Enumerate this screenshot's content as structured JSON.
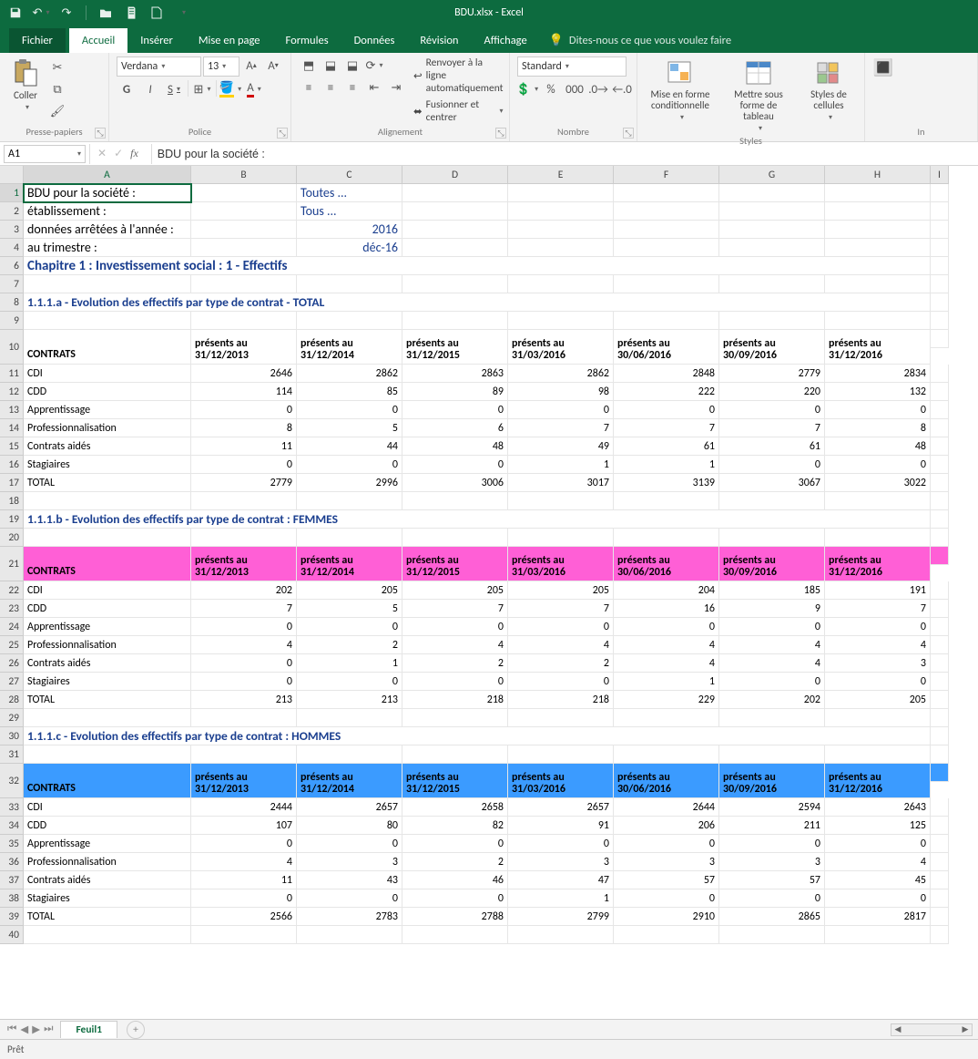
{
  "title": "BDU.xlsx  -  Excel",
  "qat": {
    "save": "save",
    "undo": "undo",
    "redo": "redo"
  },
  "tabs": {
    "file": "Fichier",
    "items": [
      "Accueil",
      "Insérer",
      "Mise en page",
      "Formules",
      "Données",
      "Révision",
      "Affichage"
    ],
    "active": "Accueil",
    "tellme": "Dites-nous ce que vous voulez faire"
  },
  "ribbon": {
    "clipboard": {
      "label": "Presse-papiers",
      "paste": "Coller"
    },
    "font": {
      "label": "Police",
      "name": "Verdana",
      "size": "13",
      "bold": "G",
      "italic": "I",
      "underline": "S"
    },
    "align": {
      "label": "Alignement",
      "wrap": "Renvoyer à la ligne automatiquement",
      "merge": "Fusionner et centrer"
    },
    "number": {
      "label": "Nombre",
      "format": "Standard"
    },
    "styles": {
      "label": "Styles",
      "cond": "Mise en forme conditionnelle",
      "table": "Mettre sous forme de tableau",
      "cell": "Styles de cellules"
    }
  },
  "fx": {
    "cellref": "A1",
    "formula": "BDU pour la société :"
  },
  "columns": [
    "A",
    "B",
    "C",
    "D",
    "E",
    "F",
    "G",
    "H",
    "I"
  ],
  "rows": {
    "1": {
      "a": "BDU pour la société :",
      "c": "Toutes ..."
    },
    "2": {
      "a": "établissement :",
      "c": "Tous ..."
    },
    "3": {
      "a": "données arrêtées à l'année :",
      "c": "2016"
    },
    "4": {
      "a": "au trimestre :",
      "c": "déc-16"
    },
    "6": "Chapitre 1 : Investissement social : 1 - Effectifs",
    "8": "1.1.1.a - Evolution des effectifs par type de contrat - TOTAL",
    "10_hdr": [
      "CONTRATS",
      "présents au 31/12/2013",
      "présents au 31/12/2014",
      "présents au 31/12/2015",
      "présents au 31/03/2016",
      "présents au 30/06/2016",
      "présents au 30/09/2016",
      "présents au 31/12/2016"
    ],
    "t1": [
      [
        "CDI",
        "2646",
        "2862",
        "2863",
        "2862",
        "2848",
        "2779",
        "2834"
      ],
      [
        "CDD",
        "114",
        "85",
        "89",
        "98",
        "222",
        "220",
        "132"
      ],
      [
        "Apprentissage",
        "0",
        "0",
        "0",
        "0",
        "0",
        "0",
        "0"
      ],
      [
        "Professionnalisation",
        "8",
        "5",
        "6",
        "7",
        "7",
        "7",
        "8"
      ],
      [
        "Contrats aidés",
        "11",
        "44",
        "48",
        "49",
        "61",
        "61",
        "48"
      ],
      [
        "Stagiaires",
        "0",
        "0",
        "0",
        "1",
        "1",
        "0",
        "0"
      ],
      [
        "TOTAL",
        "2779",
        "2996",
        "3006",
        "3017",
        "3139",
        "3067",
        "3022"
      ]
    ],
    "19": "1.1.1.b - Evolution des effectifs par type de contrat : FEMMES",
    "t2": [
      [
        "CDI",
        "202",
        "205",
        "205",
        "205",
        "204",
        "185",
        "191"
      ],
      [
        "CDD",
        "7",
        "5",
        "7",
        "7",
        "16",
        "9",
        "7"
      ],
      [
        "Apprentissage",
        "0",
        "0",
        "0",
        "0",
        "0",
        "0",
        "0"
      ],
      [
        "Professionnalisation",
        "4",
        "2",
        "4",
        "4",
        "4",
        "4",
        "4"
      ],
      [
        "Contrats aidés",
        "0",
        "1",
        "2",
        "2",
        "4",
        "4",
        "3"
      ],
      [
        "Stagiaires",
        "0",
        "0",
        "0",
        "0",
        "1",
        "0",
        "0"
      ],
      [
        "TOTAL",
        "213",
        "213",
        "218",
        "218",
        "229",
        "202",
        "205"
      ]
    ],
    "30": "1.1.1.c - Evolution des effectifs par type de contrat : HOMMES",
    "t3": [
      [
        "CDI",
        "2444",
        "2657",
        "2658",
        "2657",
        "2644",
        "2594",
        "2643"
      ],
      [
        "CDD",
        "107",
        "80",
        "82",
        "91",
        "206",
        "211",
        "125"
      ],
      [
        "Apprentissage",
        "0",
        "0",
        "0",
        "0",
        "0",
        "0",
        "0"
      ],
      [
        "Professionnalisation",
        "4",
        "3",
        "2",
        "3",
        "3",
        "3",
        "4"
      ],
      [
        "Contrats aidés",
        "11",
        "43",
        "46",
        "47",
        "57",
        "57",
        "45"
      ],
      [
        "Stagiaires",
        "0",
        "0",
        "0",
        "1",
        "0",
        "0",
        "0"
      ],
      [
        "TOTAL",
        "2566",
        "2783",
        "2788",
        "2799",
        "2910",
        "2865",
        "2817"
      ]
    ]
  },
  "sheettab": "Feuil1",
  "status": "Prêt"
}
